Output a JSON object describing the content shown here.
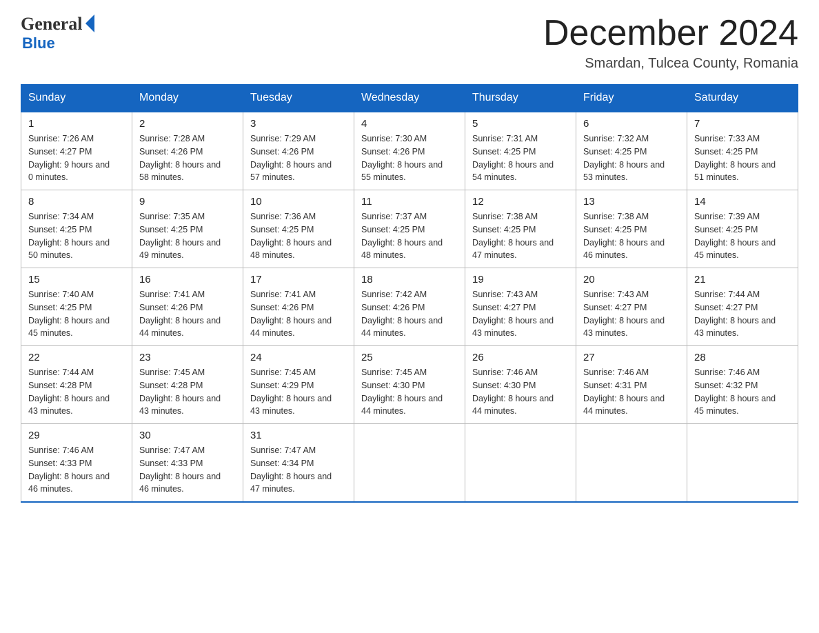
{
  "header": {
    "logo_general": "General",
    "logo_blue": "Blue",
    "month_title": "December 2024",
    "location": "Smardan, Tulcea County, Romania"
  },
  "days_of_week": [
    "Sunday",
    "Monday",
    "Tuesday",
    "Wednesday",
    "Thursday",
    "Friday",
    "Saturday"
  ],
  "weeks": [
    [
      {
        "day": "1",
        "sunrise": "7:26 AM",
        "sunset": "4:27 PM",
        "daylight": "9 hours and 0 minutes."
      },
      {
        "day": "2",
        "sunrise": "7:28 AM",
        "sunset": "4:26 PM",
        "daylight": "8 hours and 58 minutes."
      },
      {
        "day": "3",
        "sunrise": "7:29 AM",
        "sunset": "4:26 PM",
        "daylight": "8 hours and 57 minutes."
      },
      {
        "day": "4",
        "sunrise": "7:30 AM",
        "sunset": "4:26 PM",
        "daylight": "8 hours and 55 minutes."
      },
      {
        "day": "5",
        "sunrise": "7:31 AM",
        "sunset": "4:25 PM",
        "daylight": "8 hours and 54 minutes."
      },
      {
        "day": "6",
        "sunrise": "7:32 AM",
        "sunset": "4:25 PM",
        "daylight": "8 hours and 53 minutes."
      },
      {
        "day": "7",
        "sunrise": "7:33 AM",
        "sunset": "4:25 PM",
        "daylight": "8 hours and 51 minutes."
      }
    ],
    [
      {
        "day": "8",
        "sunrise": "7:34 AM",
        "sunset": "4:25 PM",
        "daylight": "8 hours and 50 minutes."
      },
      {
        "day": "9",
        "sunrise": "7:35 AM",
        "sunset": "4:25 PM",
        "daylight": "8 hours and 49 minutes."
      },
      {
        "day": "10",
        "sunrise": "7:36 AM",
        "sunset": "4:25 PM",
        "daylight": "8 hours and 48 minutes."
      },
      {
        "day": "11",
        "sunrise": "7:37 AM",
        "sunset": "4:25 PM",
        "daylight": "8 hours and 48 minutes."
      },
      {
        "day": "12",
        "sunrise": "7:38 AM",
        "sunset": "4:25 PM",
        "daylight": "8 hours and 47 minutes."
      },
      {
        "day": "13",
        "sunrise": "7:38 AM",
        "sunset": "4:25 PM",
        "daylight": "8 hours and 46 minutes."
      },
      {
        "day": "14",
        "sunrise": "7:39 AM",
        "sunset": "4:25 PM",
        "daylight": "8 hours and 45 minutes."
      }
    ],
    [
      {
        "day": "15",
        "sunrise": "7:40 AM",
        "sunset": "4:25 PM",
        "daylight": "8 hours and 45 minutes."
      },
      {
        "day": "16",
        "sunrise": "7:41 AM",
        "sunset": "4:26 PM",
        "daylight": "8 hours and 44 minutes."
      },
      {
        "day": "17",
        "sunrise": "7:41 AM",
        "sunset": "4:26 PM",
        "daylight": "8 hours and 44 minutes."
      },
      {
        "day": "18",
        "sunrise": "7:42 AM",
        "sunset": "4:26 PM",
        "daylight": "8 hours and 44 minutes."
      },
      {
        "day": "19",
        "sunrise": "7:43 AM",
        "sunset": "4:27 PM",
        "daylight": "8 hours and 43 minutes."
      },
      {
        "day": "20",
        "sunrise": "7:43 AM",
        "sunset": "4:27 PM",
        "daylight": "8 hours and 43 minutes."
      },
      {
        "day": "21",
        "sunrise": "7:44 AM",
        "sunset": "4:27 PM",
        "daylight": "8 hours and 43 minutes."
      }
    ],
    [
      {
        "day": "22",
        "sunrise": "7:44 AM",
        "sunset": "4:28 PM",
        "daylight": "8 hours and 43 minutes."
      },
      {
        "day": "23",
        "sunrise": "7:45 AM",
        "sunset": "4:28 PM",
        "daylight": "8 hours and 43 minutes."
      },
      {
        "day": "24",
        "sunrise": "7:45 AM",
        "sunset": "4:29 PM",
        "daylight": "8 hours and 43 minutes."
      },
      {
        "day": "25",
        "sunrise": "7:45 AM",
        "sunset": "4:30 PM",
        "daylight": "8 hours and 44 minutes."
      },
      {
        "day": "26",
        "sunrise": "7:46 AM",
        "sunset": "4:30 PM",
        "daylight": "8 hours and 44 minutes."
      },
      {
        "day": "27",
        "sunrise": "7:46 AM",
        "sunset": "4:31 PM",
        "daylight": "8 hours and 44 minutes."
      },
      {
        "day": "28",
        "sunrise": "7:46 AM",
        "sunset": "4:32 PM",
        "daylight": "8 hours and 45 minutes."
      }
    ],
    [
      {
        "day": "29",
        "sunrise": "7:46 AM",
        "sunset": "4:33 PM",
        "daylight": "8 hours and 46 minutes."
      },
      {
        "day": "30",
        "sunrise": "7:47 AM",
        "sunset": "4:33 PM",
        "daylight": "8 hours and 46 minutes."
      },
      {
        "day": "31",
        "sunrise": "7:47 AM",
        "sunset": "4:34 PM",
        "daylight": "8 hours and 47 minutes."
      },
      null,
      null,
      null,
      null
    ]
  ],
  "labels": {
    "sunrise_prefix": "Sunrise: ",
    "sunset_prefix": "Sunset: ",
    "daylight_prefix": "Daylight: "
  }
}
